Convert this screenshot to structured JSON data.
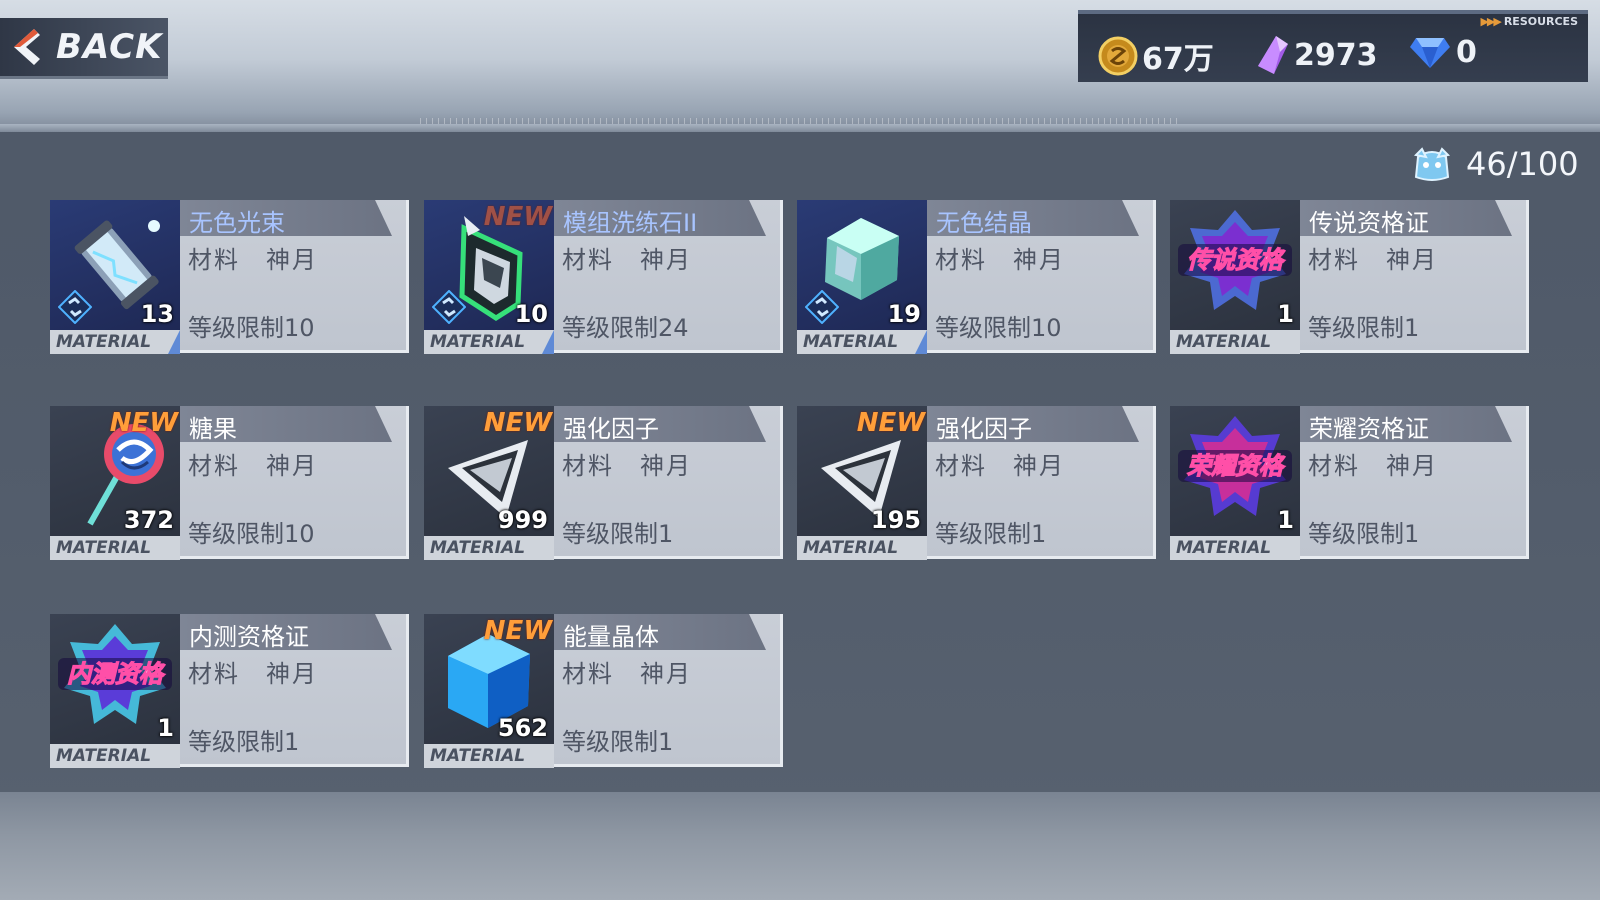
{
  "header": {
    "back_label": "BACK",
    "resources_label": "RESOURCES",
    "resources": [
      {
        "icon": "gold-coin-icon",
        "value": "67万"
      },
      {
        "icon": "purple-crystal-icon",
        "value": "2973"
      },
      {
        "icon": "diamond-icon",
        "value": "0"
      }
    ]
  },
  "capacity": {
    "icon": "bag-icon",
    "value": "46/100"
  },
  "items": [
    {
      "name": "无色光束",
      "category": "材料　神月",
      "level": "等级限制10",
      "qty": "13",
      "new": false,
      "tag": "MATERIAL",
      "accent": true,
      "icon": "light-beam-capsule-icon",
      "blue": true
    },
    {
      "name": "模组洗练石II",
      "category": "材料　神月",
      "level": "等级限制24",
      "qty": "10",
      "new": true,
      "tag": "MATERIAL",
      "accent": true,
      "icon": "module-stone-icon",
      "blue": true
    },
    {
      "name": "无色结晶",
      "category": "材料　神月",
      "level": "等级限制10",
      "qty": "19",
      "new": false,
      "tag": "MATERIAL",
      "accent": true,
      "icon": "crystal-cube-icon",
      "blue": true
    },
    {
      "name": "传说资格证",
      "category": "材料　神月",
      "level": "等级限制1",
      "qty": "1",
      "new": false,
      "tag": "MATERIAL",
      "accent": false,
      "icon": "legend-badge-icon",
      "badge_text": "传说资格"
    },
    {
      "name": "糖果",
      "category": "材料　神月",
      "level": "等级限制10",
      "qty": "372",
      "new": true,
      "tag": "MATERIAL",
      "accent": false,
      "icon": "lollipop-icon"
    },
    {
      "name": "强化因子",
      "category": "材料　神月",
      "level": "等级限制1",
      "qty": "999",
      "new": true,
      "tag": "MATERIAL",
      "accent": false,
      "icon": "enhance-factor-icon"
    },
    {
      "name": "强化因子",
      "category": "材料　神月",
      "level": "等级限制1",
      "qty": "195",
      "new": true,
      "tag": "MATERIAL",
      "accent": false,
      "icon": "enhance-factor-icon"
    },
    {
      "name": "荣耀资格证",
      "category": "材料　神月",
      "level": "等级限制1",
      "qty": "1",
      "new": false,
      "tag": "MATERIAL",
      "accent": false,
      "icon": "glory-badge-icon",
      "badge_text": "荣耀资格"
    },
    {
      "name": "内测资格证",
      "category": "材料　神月",
      "level": "等级限制1",
      "qty": "1",
      "new": false,
      "tag": "MATERIAL",
      "accent": false,
      "icon": "beta-badge-icon",
      "badge_text": "内测资格"
    },
    {
      "name": "能量晶体",
      "category": "材料　神月",
      "level": "等级限制1",
      "qty": "562",
      "new": true,
      "tag": "MATERIAL",
      "accent": false,
      "icon": "energy-cube-icon"
    }
  ]
}
